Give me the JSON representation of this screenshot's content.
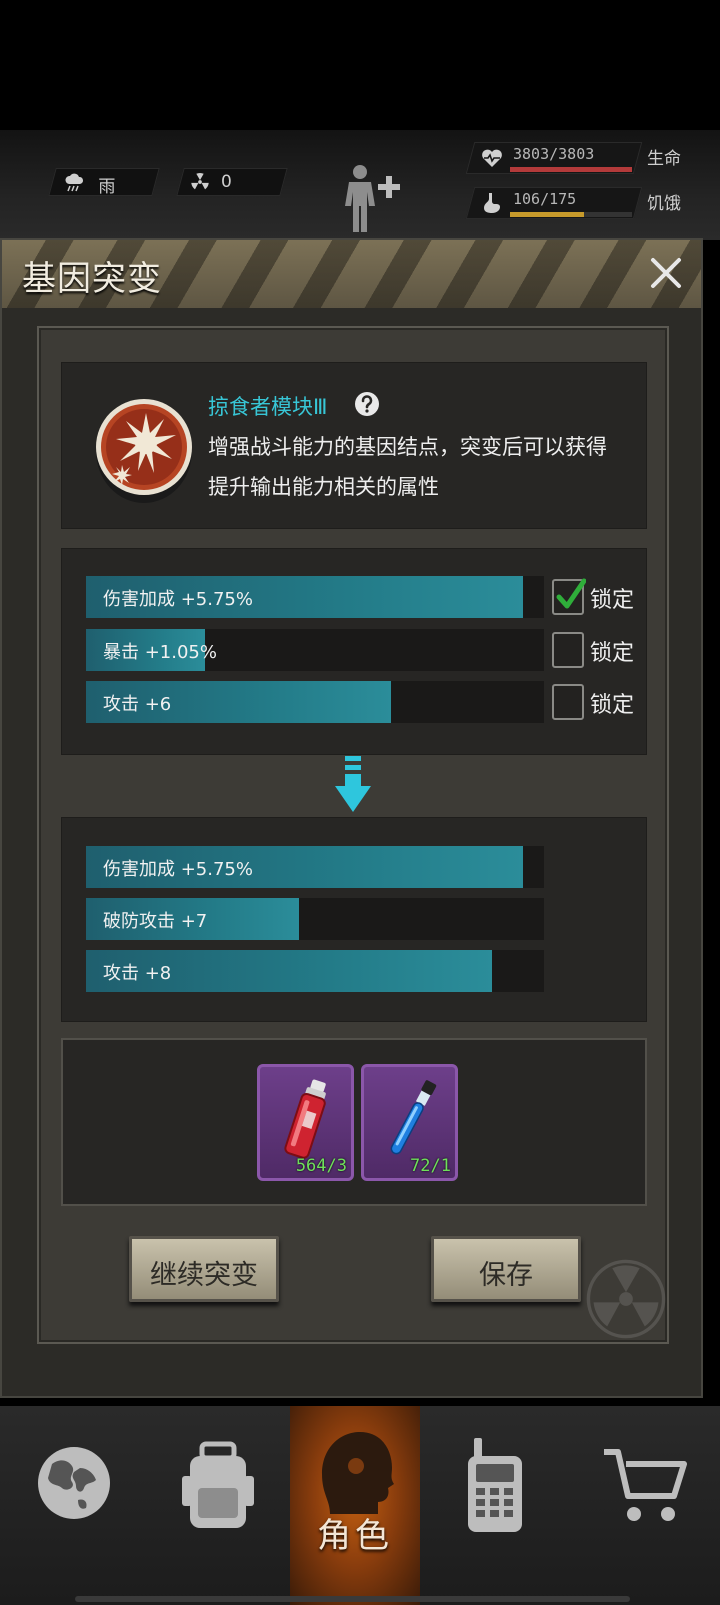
{
  "hud": {
    "weather": "雨",
    "radiation": "0",
    "life_value": "3803/3803",
    "life_label": "生命",
    "life_fraction": 1.0,
    "hunger_value": "106/175",
    "hunger_label": "饥饿",
    "hunger_fraction": 0.606
  },
  "dialog": {
    "title": "基因突变",
    "gene": {
      "name": "掠食者模块Ⅲ",
      "desc_line1": "增强战斗能力的基因结点，突变后可以获得",
      "desc_line2": "提升输出能力相关的属性"
    },
    "current_attributes": [
      {
        "text": "伤害加成 +5.75%",
        "fill": 0.955,
        "locked": true,
        "lock_label": "锁定"
      },
      {
        "text": "暴击 +1.05%",
        "fill": 0.26,
        "locked": false,
        "lock_label": "锁定"
      },
      {
        "text": "攻击 +6",
        "fill": 0.665,
        "locked": false,
        "lock_label": "锁定"
      }
    ],
    "new_attributes": [
      {
        "text": "伤害加成 +5.75%",
        "fill": 0.955
      },
      {
        "text": "破防攻击 +7",
        "fill": 0.465
      },
      {
        "text": "攻击 +8",
        "fill": 0.887
      }
    ],
    "materials": [
      {
        "icon": "red-vial-icon",
        "count": "564/3"
      },
      {
        "icon": "blue-test-tube-icon",
        "count": "72/1"
      }
    ],
    "continue_label": "继续突变",
    "save_label": "保存"
  },
  "nav": {
    "role_label": "角色"
  },
  "colors": {
    "attr_fill": "#237b88",
    "gene_name": "#38c6d6",
    "material_count": "#6fe05a",
    "selected_tab": "#c25f10"
  }
}
